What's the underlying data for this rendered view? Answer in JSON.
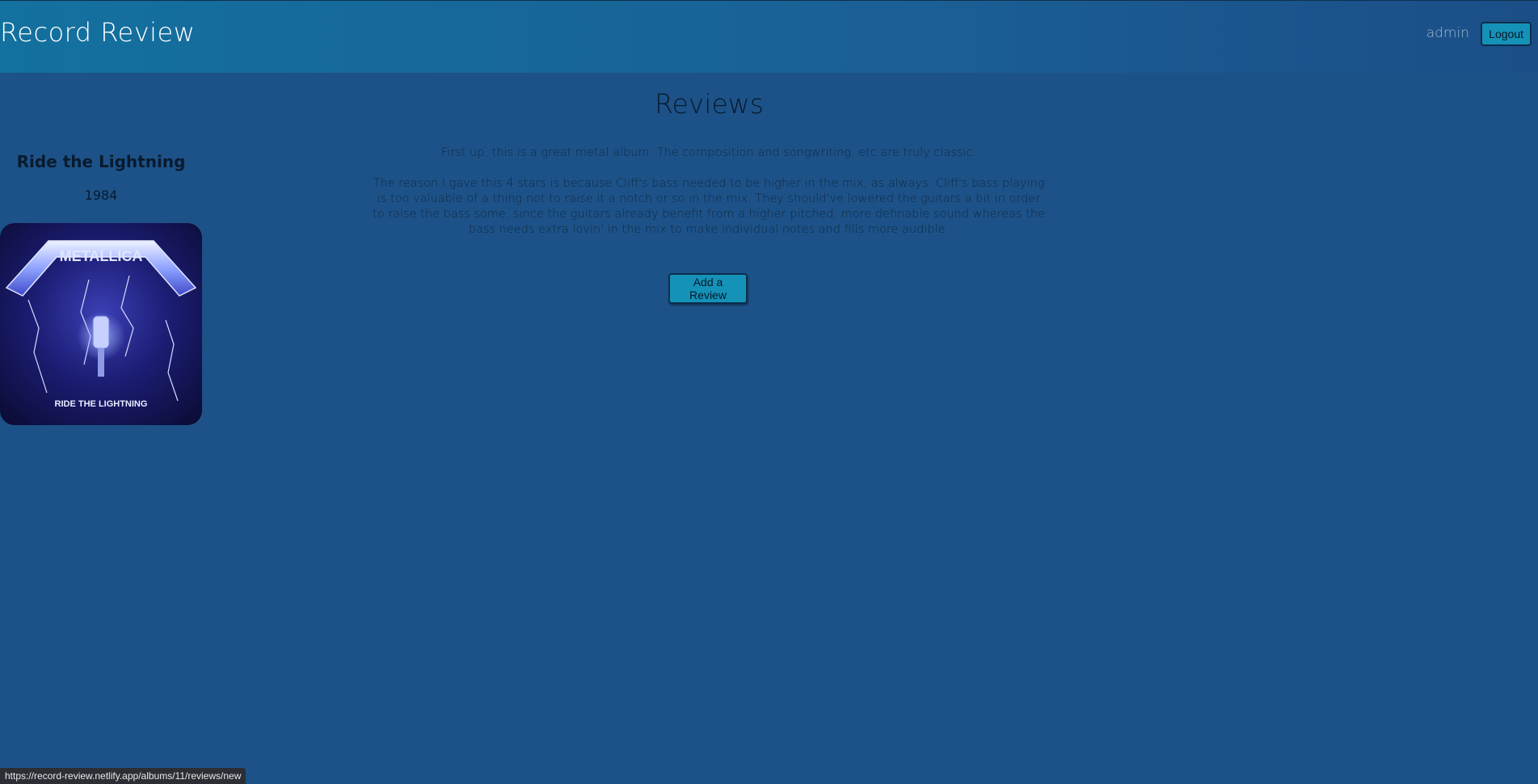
{
  "header": {
    "brand": "Record Review",
    "username": "admin",
    "logout_label": "Logout"
  },
  "main": {
    "title": "Reviews",
    "album": {
      "title": "Ride the Lightning",
      "year": "1984",
      "cover_text": "RIDE THE LIGHTNING",
      "cover_logo_text": "METALLICA"
    },
    "reviews": [
      "First up, this is a great metal album. The composition and songwriting, etc are truly classic.",
      "The reason I gave this 4 stars is because Cliff's bass needed to be higher in the mix, as always. Cliff's bass playing is too valuable of a thing not to raise it a notch or so in the mix. They should've lowered the guitars a bit in order to raise the bass some, since the guitars already benefit from a higher pitched, more definable sound whereas the bass needs extra lovin' in the mix to make individual notes and fills more audible."
    ],
    "add_review_label": "Add a Review"
  },
  "status_bar": {
    "url": "https://record-review.netlify.app/albums/11/reviews/new"
  },
  "colors": {
    "background": "#1d5288",
    "header_start": "#13719f",
    "header_end": "#1b4e86",
    "button": "#1592b8"
  }
}
